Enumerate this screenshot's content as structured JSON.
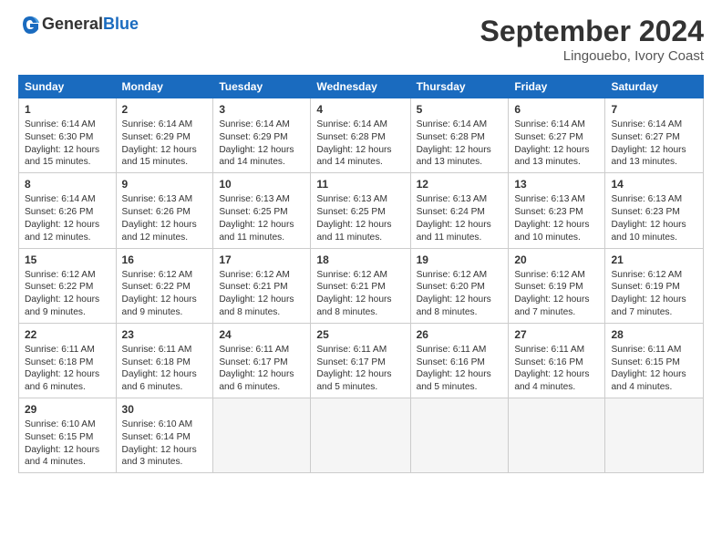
{
  "header": {
    "logo_general": "General",
    "logo_blue": "Blue",
    "month_title": "September 2024",
    "location": "Lingouebo, Ivory Coast"
  },
  "days_of_week": [
    "Sunday",
    "Monday",
    "Tuesday",
    "Wednesday",
    "Thursday",
    "Friday",
    "Saturday"
  ],
  "weeks": [
    [
      {
        "day": "1",
        "lines": [
          "Sunrise: 6:14 AM",
          "Sunset: 6:30 PM",
          "Daylight: 12 hours",
          "and 15 minutes."
        ]
      },
      {
        "day": "2",
        "lines": [
          "Sunrise: 6:14 AM",
          "Sunset: 6:29 PM",
          "Daylight: 12 hours",
          "and 15 minutes."
        ]
      },
      {
        "day": "3",
        "lines": [
          "Sunrise: 6:14 AM",
          "Sunset: 6:29 PM",
          "Daylight: 12 hours",
          "and 14 minutes."
        ]
      },
      {
        "day": "4",
        "lines": [
          "Sunrise: 6:14 AM",
          "Sunset: 6:28 PM",
          "Daylight: 12 hours",
          "and 14 minutes."
        ]
      },
      {
        "day": "5",
        "lines": [
          "Sunrise: 6:14 AM",
          "Sunset: 6:28 PM",
          "Daylight: 12 hours",
          "and 13 minutes."
        ]
      },
      {
        "day": "6",
        "lines": [
          "Sunrise: 6:14 AM",
          "Sunset: 6:27 PM",
          "Daylight: 12 hours",
          "and 13 minutes."
        ]
      },
      {
        "day": "7",
        "lines": [
          "Sunrise: 6:14 AM",
          "Sunset: 6:27 PM",
          "Daylight: 12 hours",
          "and 13 minutes."
        ]
      }
    ],
    [
      {
        "day": "8",
        "lines": [
          "Sunrise: 6:14 AM",
          "Sunset: 6:26 PM",
          "Daylight: 12 hours",
          "and 12 minutes."
        ]
      },
      {
        "day": "9",
        "lines": [
          "Sunrise: 6:13 AM",
          "Sunset: 6:26 PM",
          "Daylight: 12 hours",
          "and 12 minutes."
        ]
      },
      {
        "day": "10",
        "lines": [
          "Sunrise: 6:13 AM",
          "Sunset: 6:25 PM",
          "Daylight: 12 hours",
          "and 11 minutes."
        ]
      },
      {
        "day": "11",
        "lines": [
          "Sunrise: 6:13 AM",
          "Sunset: 6:25 PM",
          "Daylight: 12 hours",
          "and 11 minutes."
        ]
      },
      {
        "day": "12",
        "lines": [
          "Sunrise: 6:13 AM",
          "Sunset: 6:24 PM",
          "Daylight: 12 hours",
          "and 11 minutes."
        ]
      },
      {
        "day": "13",
        "lines": [
          "Sunrise: 6:13 AM",
          "Sunset: 6:23 PM",
          "Daylight: 12 hours",
          "and 10 minutes."
        ]
      },
      {
        "day": "14",
        "lines": [
          "Sunrise: 6:13 AM",
          "Sunset: 6:23 PM",
          "Daylight: 12 hours",
          "and 10 minutes."
        ]
      }
    ],
    [
      {
        "day": "15",
        "lines": [
          "Sunrise: 6:12 AM",
          "Sunset: 6:22 PM",
          "Daylight: 12 hours",
          "and 9 minutes."
        ]
      },
      {
        "day": "16",
        "lines": [
          "Sunrise: 6:12 AM",
          "Sunset: 6:22 PM",
          "Daylight: 12 hours",
          "and 9 minutes."
        ]
      },
      {
        "day": "17",
        "lines": [
          "Sunrise: 6:12 AM",
          "Sunset: 6:21 PM",
          "Daylight: 12 hours",
          "and 8 minutes."
        ]
      },
      {
        "day": "18",
        "lines": [
          "Sunrise: 6:12 AM",
          "Sunset: 6:21 PM",
          "Daylight: 12 hours",
          "and 8 minutes."
        ]
      },
      {
        "day": "19",
        "lines": [
          "Sunrise: 6:12 AM",
          "Sunset: 6:20 PM",
          "Daylight: 12 hours",
          "and 8 minutes."
        ]
      },
      {
        "day": "20",
        "lines": [
          "Sunrise: 6:12 AM",
          "Sunset: 6:19 PM",
          "Daylight: 12 hours",
          "and 7 minutes."
        ]
      },
      {
        "day": "21",
        "lines": [
          "Sunrise: 6:12 AM",
          "Sunset: 6:19 PM",
          "Daylight: 12 hours",
          "and 7 minutes."
        ]
      }
    ],
    [
      {
        "day": "22",
        "lines": [
          "Sunrise: 6:11 AM",
          "Sunset: 6:18 PM",
          "Daylight: 12 hours",
          "and 6 minutes."
        ]
      },
      {
        "day": "23",
        "lines": [
          "Sunrise: 6:11 AM",
          "Sunset: 6:18 PM",
          "Daylight: 12 hours",
          "and 6 minutes."
        ]
      },
      {
        "day": "24",
        "lines": [
          "Sunrise: 6:11 AM",
          "Sunset: 6:17 PM",
          "Daylight: 12 hours",
          "and 6 minutes."
        ]
      },
      {
        "day": "25",
        "lines": [
          "Sunrise: 6:11 AM",
          "Sunset: 6:17 PM",
          "Daylight: 12 hours",
          "and 5 minutes."
        ]
      },
      {
        "day": "26",
        "lines": [
          "Sunrise: 6:11 AM",
          "Sunset: 6:16 PM",
          "Daylight: 12 hours",
          "and 5 minutes."
        ]
      },
      {
        "day": "27",
        "lines": [
          "Sunrise: 6:11 AM",
          "Sunset: 6:16 PM",
          "Daylight: 12 hours",
          "and 4 minutes."
        ]
      },
      {
        "day": "28",
        "lines": [
          "Sunrise: 6:11 AM",
          "Sunset: 6:15 PM",
          "Daylight: 12 hours",
          "and 4 minutes."
        ]
      }
    ],
    [
      {
        "day": "29",
        "lines": [
          "Sunrise: 6:10 AM",
          "Sunset: 6:15 PM",
          "Daylight: 12 hours",
          "and 4 minutes."
        ]
      },
      {
        "day": "30",
        "lines": [
          "Sunrise: 6:10 AM",
          "Sunset: 6:14 PM",
          "Daylight: 12 hours",
          "and 3 minutes."
        ]
      },
      {
        "day": "",
        "lines": []
      },
      {
        "day": "",
        "lines": []
      },
      {
        "day": "",
        "lines": []
      },
      {
        "day": "",
        "lines": []
      },
      {
        "day": "",
        "lines": []
      }
    ]
  ]
}
